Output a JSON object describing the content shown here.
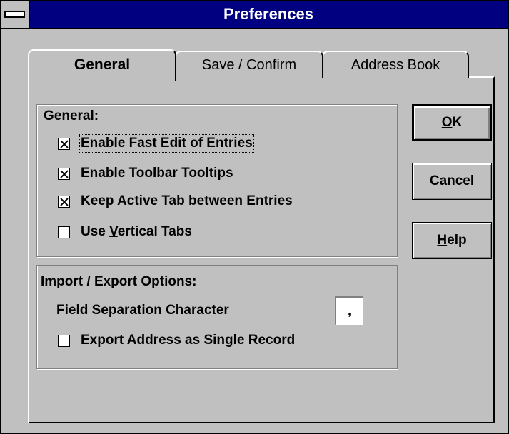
{
  "window": {
    "title": "Preferences"
  },
  "tabs": [
    {
      "label": "General",
      "active": true
    },
    {
      "label": "Save / Confirm",
      "active": false
    },
    {
      "label": "Address Book",
      "active": false
    }
  ],
  "general_group": {
    "label": "General:",
    "options": [
      {
        "pre": "Enable ",
        "key": "F",
        "post": "ast Edit of Entries",
        "checked": true
      },
      {
        "pre": "Enable Toolbar ",
        "key": "T",
        "post": "ooltips",
        "checked": true
      },
      {
        "pre": "",
        "key": "K",
        "post": "eep Active Tab between Entries",
        "checked": true
      },
      {
        "pre": "Use ",
        "key": "V",
        "post": "ertical Tabs",
        "checked": false
      }
    ]
  },
  "import_group": {
    "label": "Import / Export Options:",
    "field_label": "Field Separation Character",
    "field_value": ",",
    "export_option": {
      "pre": "Export Address as ",
      "key": "S",
      "post": "ingle Record",
      "checked": false
    }
  },
  "buttons": {
    "ok": {
      "key": "O",
      "post": "K"
    },
    "cancel": {
      "key": "C",
      "post": "ancel"
    },
    "help": {
      "key": "H",
      "post": "elp"
    }
  }
}
